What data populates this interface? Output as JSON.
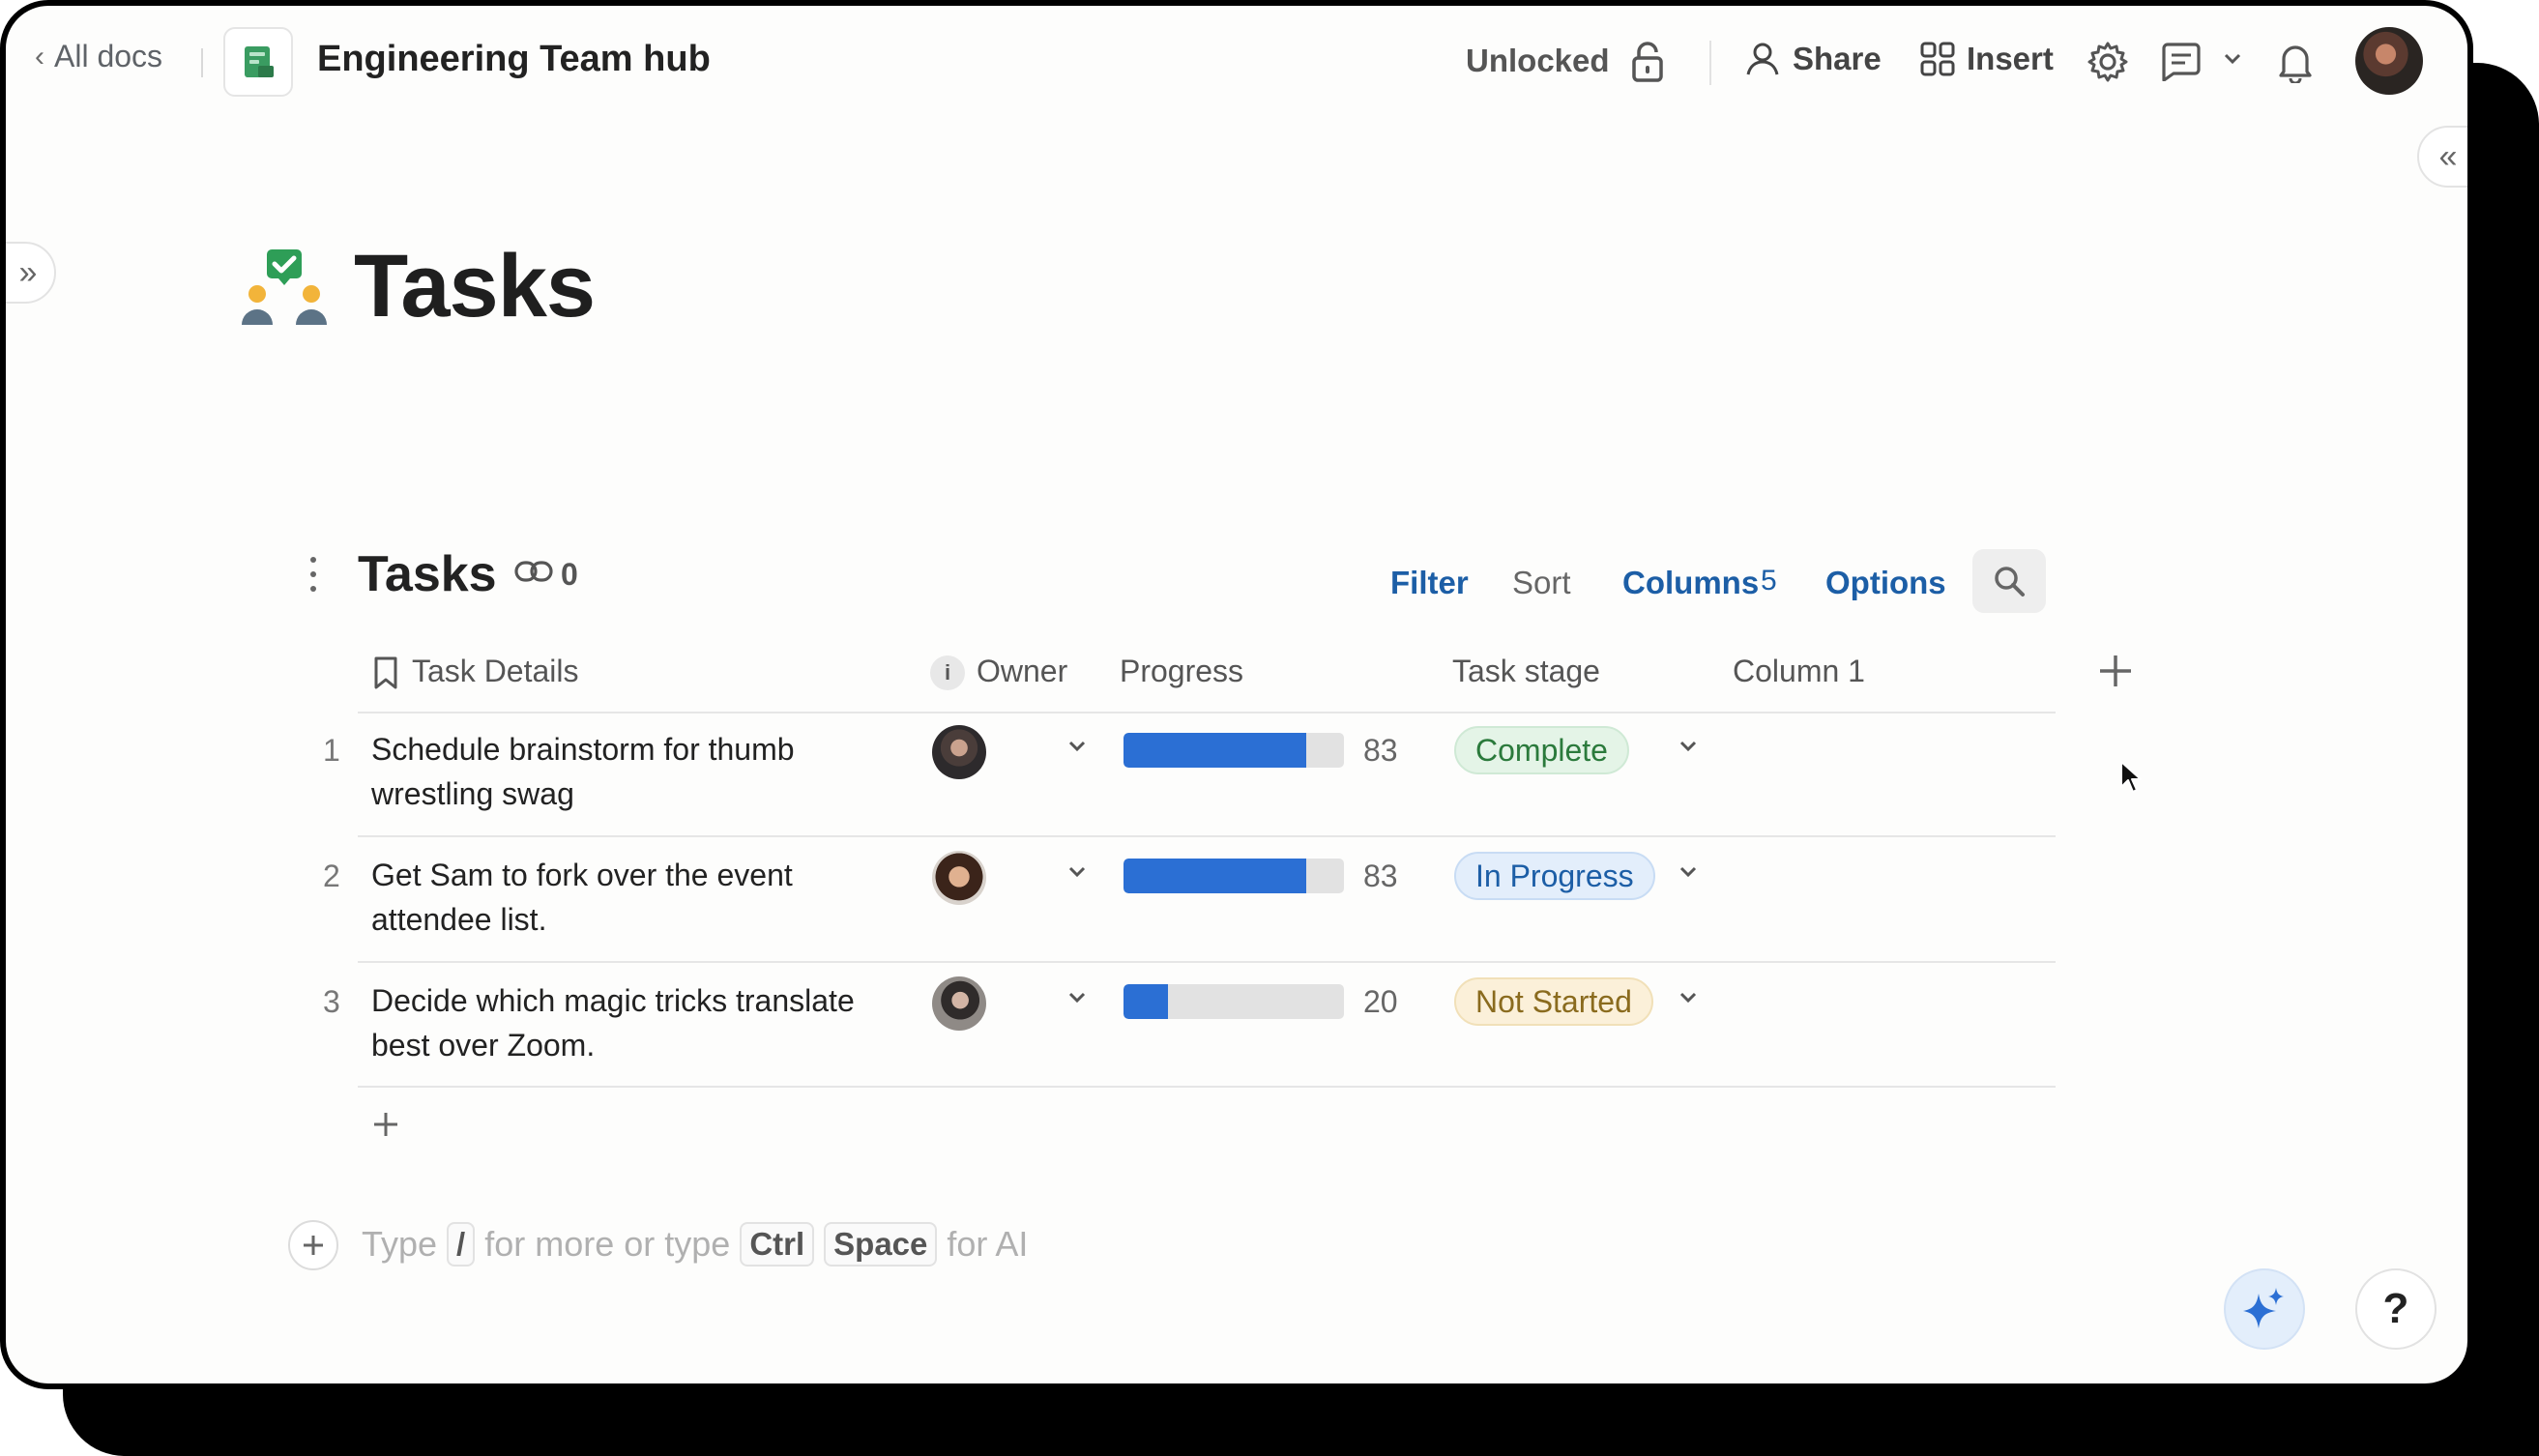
{
  "topbar": {
    "back_label": "All docs",
    "doc_title": "Engineering Team hub",
    "lock_status": "Unlocked",
    "share_label": "Share",
    "insert_label": "Insert"
  },
  "page": {
    "title": "Tasks"
  },
  "table": {
    "title": "Tasks",
    "link_count": "0",
    "toolbar": {
      "filter": "Filter",
      "sort": "Sort",
      "columns": "Columns",
      "columns_count": "5",
      "options": "Options"
    },
    "columns": {
      "task_details": "Task Details",
      "owner_info": "i",
      "owner": "Owner",
      "progress": "Progress",
      "task_stage": "Task stage",
      "column1": "Column 1"
    },
    "rows": [
      {
        "num": "1",
        "task": "Schedule brainstorm for thumb wrestling swag",
        "progress": 83,
        "progress_label": "83",
        "stage": "Complete"
      },
      {
        "num": "2",
        "task": "Get Sam to fork over the event attendee list.",
        "progress": 83,
        "progress_label": "83",
        "stage": "In Progress"
      },
      {
        "num": "3",
        "task": "Decide which magic tricks translate best over Zoom.",
        "progress": 20,
        "progress_label": "20",
        "stage": "Not Started"
      }
    ]
  },
  "composer": {
    "type": "Type",
    "slash": "/",
    "for_more": "for more or type",
    "ctrl": "Ctrl",
    "space": "Space",
    "for_ai": "for AI"
  },
  "help_label": "?",
  "colors": {
    "accent": "#1c5ea6",
    "progress_bar": "#2b6fd4",
    "complete": "#2b7a3c",
    "in_progress": "#1c5ea6",
    "not_started": "#8a6b1e"
  },
  "icons": [
    "chevron-left-icon",
    "doc-icon",
    "lock-icon",
    "person-icon",
    "grid-icon",
    "gear-icon",
    "comment-icon",
    "chevron-down-icon",
    "bell-icon",
    "avatar",
    "double-chevron-left-icon",
    "double-chevron-right-icon",
    "tasks-page-icon",
    "kebab-icon",
    "link-icon",
    "search-icon",
    "bookmark-icon",
    "info-icon",
    "plus-icon",
    "sparkle-icon",
    "help-icon",
    "cursor-icon"
  ]
}
